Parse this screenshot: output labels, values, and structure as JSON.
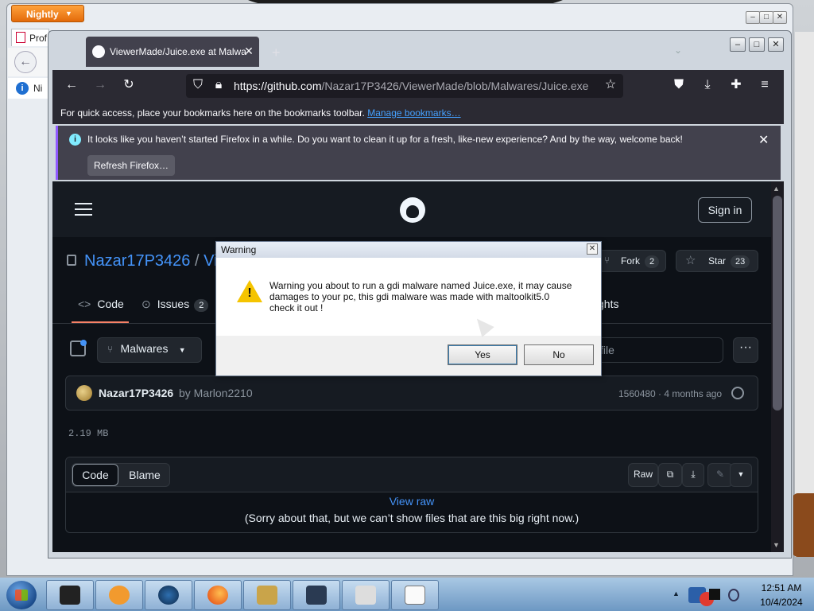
{
  "back_window": {
    "menu_button": "Nightly",
    "tab_label": "Prof",
    "info_text": "Ni"
  },
  "browser": {
    "tab_title": "ViewerMade/Juice.exe at Malwa",
    "url_host": "https://github.com",
    "url_path": "/Nazar17P3426/ViewerMade/blob/Malwares/Juice.exe",
    "bookmarks_text": "For quick access, place your bookmarks here on the bookmarks toolbar.",
    "bookmarks_link": "Manage bookmarks…",
    "notification_text": "It looks like you haven’t started Firefox in a while. Do you want to clean it up for a fresh, like-new experience? And by the way, welcome back!",
    "refresh_button": "Refresh Firefox…"
  },
  "github": {
    "signin": "Sign in",
    "repo_owner": "Nazar17P3426",
    "repo_separator": "/",
    "repo_name_partial": "Vie",
    "fork_label": "Fork",
    "fork_count": "2",
    "star_label": "Star",
    "star_count": "23",
    "tabs": {
      "code": "Code",
      "issues": "Issues",
      "issues_count": "2",
      "insights_partial": "ghts"
    },
    "branch": "Malwares",
    "goto_file_partial": "file",
    "commit": {
      "author": "Nazar17P3426",
      "by": "by Marlon2210",
      "meta": "1560480 · 4 months ago"
    },
    "file_size": "2.19 MB",
    "file_view": {
      "code": "Code",
      "blame": "Blame",
      "raw": "Raw",
      "view_raw": "View raw",
      "sorry": "(Sorry about that, but we can’t show files that are this big right now.)"
    }
  },
  "dialog": {
    "title": "Warning",
    "message": "Warning you about to run a gdi malware named Juice.exe, it may cause\ndamages to your pc, this gdi malware was made with maltoolkit5.0\ncheck it out !",
    "yes": "Yes",
    "no": "No"
  },
  "taskbar": {
    "time": "12:51 AM",
    "date": "10/4/2024"
  },
  "colors": {
    "firefox_dark": "#2b2a33",
    "github_bg": "#0d1117",
    "link_blue": "#4493f8",
    "nightly_orange": "#e36a0a"
  }
}
